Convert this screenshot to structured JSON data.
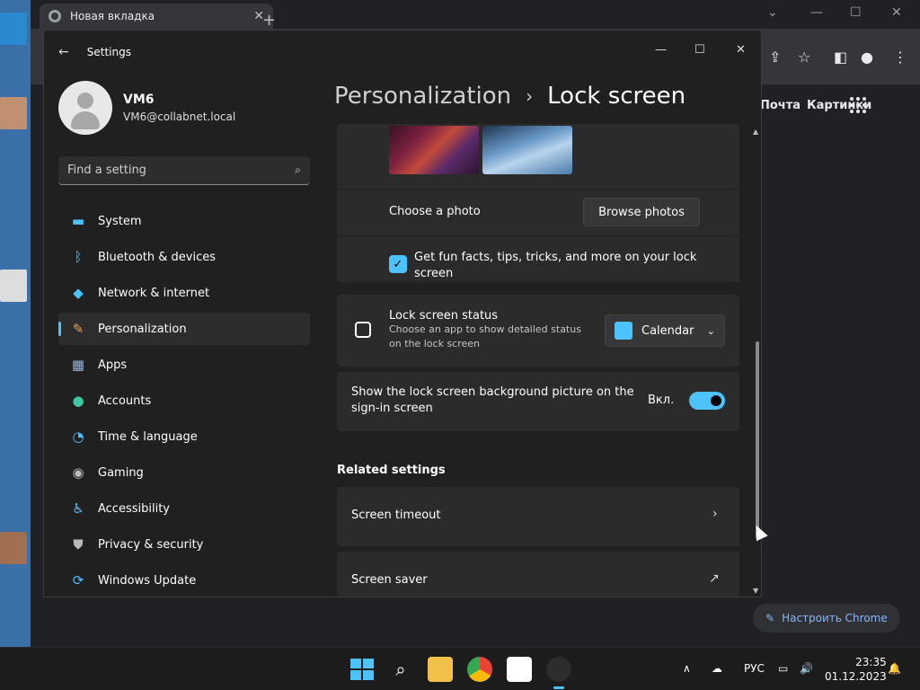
{
  "chrome": {
    "tab_title": "Новая вкладка",
    "links": [
      "Почта",
      "Картинки"
    ],
    "customize_label": "Настроить Chrome"
  },
  "settings": {
    "window_title": "Settings",
    "profile": {
      "name": "VM6",
      "email": "VM6@collabnet.local"
    },
    "search_placeholder": "Find a setting",
    "nav": [
      {
        "label": "System",
        "icon": "monitor-icon",
        "color": "#4cc2ff"
      },
      {
        "label": "Bluetooth & devices",
        "icon": "bluetooth-icon",
        "color": "#4cc2ff"
      },
      {
        "label": "Network & internet",
        "icon": "wifi-icon",
        "color": "#4cc2ff"
      },
      {
        "label": "Personalization",
        "icon": "brush-icon",
        "color": "#e8a060",
        "active": true
      },
      {
        "label": "Apps",
        "icon": "apps-icon",
        "color": "#9ab4d8"
      },
      {
        "label": "Accounts",
        "icon": "person-icon",
        "color": "#3cc8a0"
      },
      {
        "label": "Time & language",
        "icon": "globe-clock-icon",
        "color": "#4cc2ff"
      },
      {
        "label": "Gaming",
        "icon": "gamepad-icon",
        "color": "#bbbbbb"
      },
      {
        "label": "Accessibility",
        "icon": "accessibility-icon",
        "color": "#4cc2ff"
      },
      {
        "label": "Privacy & security",
        "icon": "shield-icon",
        "color": "#bbbbbb"
      },
      {
        "label": "Windows Update",
        "icon": "update-icon",
        "color": "#4cc2ff"
      }
    ],
    "breadcrumb": {
      "parent": "Personalization",
      "current": "Lock screen"
    },
    "content": {
      "choose_photo_label": "Choose a photo",
      "browse_button": "Browse photos",
      "fun_facts_label": "Get fun facts, tips, tricks, and more on your lock screen",
      "fun_facts_checked": true,
      "lock_status_title": "Lock screen status",
      "lock_status_desc": "Choose an app to show detailed status on the lock screen",
      "lock_status_value": "Calendar",
      "signin_bg_label": "Show the lock screen background picture on the sign-in screen",
      "signin_bg_state": "Вкл.",
      "signin_bg_on": true,
      "related_header": "Related settings",
      "related": [
        {
          "label": "Screen timeout",
          "type": "chevron"
        },
        {
          "label": "Screen saver",
          "type": "external"
        }
      ]
    }
  },
  "taskbar": {
    "lang": "РУС",
    "time": "23:35",
    "date": "01.12.2023"
  },
  "colors": {
    "accent": "#4cc2ff"
  }
}
